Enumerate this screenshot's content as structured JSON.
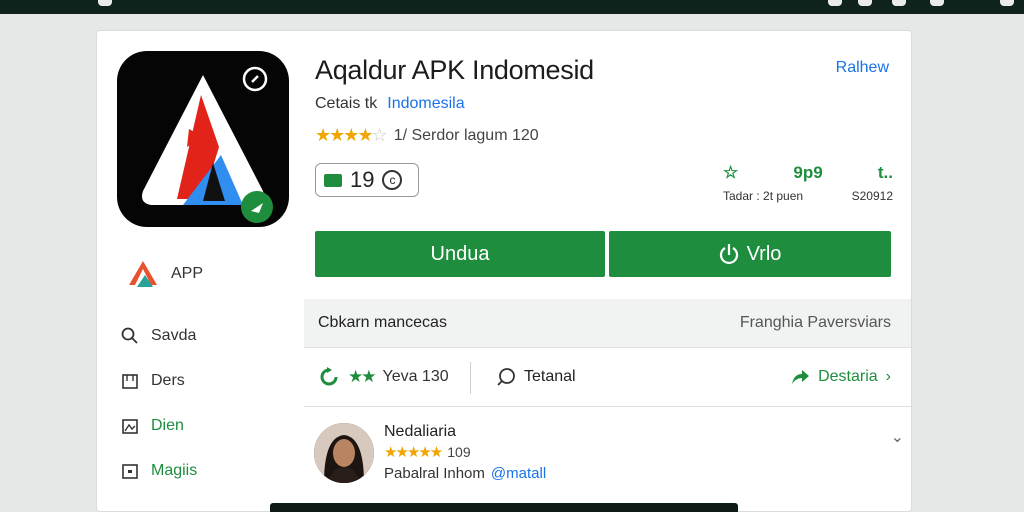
{
  "app": {
    "title": "Aqaldur APK Indomesid",
    "top_link": "Ralhew",
    "developer_label": "Cetais tk",
    "developer_link": "Indomesila",
    "rating_text": "1/ Serdor lagum 120",
    "badge_value": "19",
    "stats": {
      "value_2": "9p9",
      "value_3": "t..",
      "label_1": "Tadar : 2t puen",
      "label_2": "S20912"
    },
    "download_label": "Undua",
    "secondary_label": "Vrlo"
  },
  "sidebar": {
    "brand": "APP",
    "items": [
      {
        "label": "Savda"
      },
      {
        "label": "Ders"
      },
      {
        "label": "Dien"
      },
      {
        "label": "Magiis"
      }
    ]
  },
  "panel": {
    "header_left": "Cbkarn mancecas",
    "header_right": "Franghia Paversviars",
    "action_rating": "Yeva 130",
    "action_comment": "Tetanal",
    "action_share": "Destaria"
  },
  "review": {
    "name": "Nedaliaria",
    "count": "109",
    "body": "Pabalral Inhom",
    "mention": "@matall"
  },
  "colors": {
    "accent_green": "#1e8e3e",
    "link_blue": "#1a73e8",
    "star_gold": "#f0a500"
  }
}
